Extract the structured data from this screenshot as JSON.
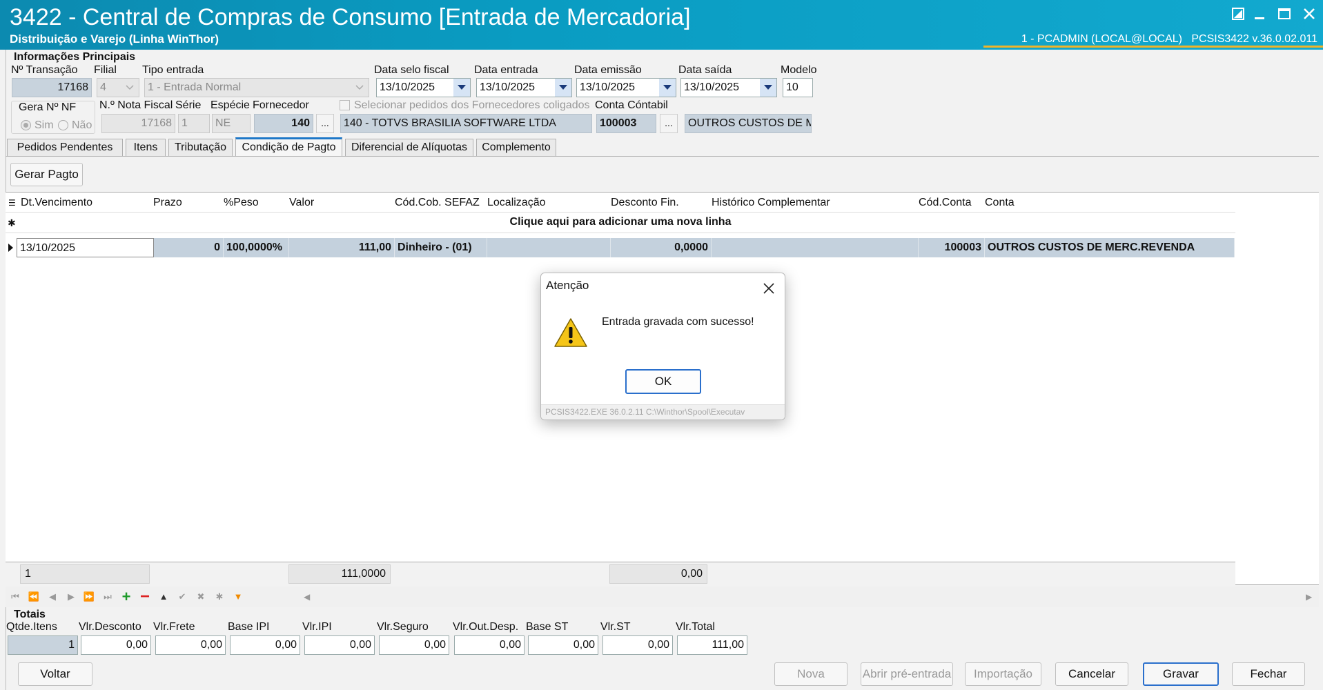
{
  "window": {
    "title": "3422 - Central de Compras de Consumo [Entrada de Mercadoria]",
    "subtitle": "Distribuição e Varejo (Linha WinThor)",
    "user_info": "1 - PCADMIN (LOCAL@LOCAL)",
    "version": "PCSIS3422  v.36.0.02.011"
  },
  "info": {
    "section_title": "Informações Principais",
    "transacao_label": "Nº Transação",
    "transacao_value": "17168",
    "filial_label": "Filial",
    "filial_value": "4",
    "tipo_entrada_label": "Tipo entrada",
    "tipo_entrada_value": "1 - Entrada Normal",
    "data_selo_label": "Data selo fiscal",
    "data_selo_value": "13/10/2025",
    "data_entrada_label": "Data entrada",
    "data_entrada_value": "13/10/2025",
    "data_emissao_label": "Data emissão",
    "data_emissao_value": "13/10/2025",
    "data_saida_label": "Data saída",
    "data_saida_value": "13/10/2025",
    "modelo_label": "Modelo",
    "modelo_value": "10",
    "gera_nf_label": "Gera Nº NF",
    "sim_label": "Sim",
    "nao_label": "Não",
    "nota_fiscal_label": "N.º Nota Fiscal",
    "nota_fiscal_value": "17168",
    "serie_label": "Série",
    "serie_value": "1",
    "especie_label": "Espécie",
    "especie_value": "NE",
    "fornecedor_label": "Fornecedor",
    "fornecedor_code": "140",
    "fornecedor_name": "140 - TOTVS BRASILIA SOFTWARE LTDA",
    "coligados_label": "Selecionar pedidos dos Fornecedores coligados",
    "conta_contabil_label": "Conta Cóntabil",
    "conta_contabil_code": "100003",
    "conta_contabil_name": "OUTROS CUSTOS DE MERC.REVENDA",
    "ellipsis": "..."
  },
  "tabs": [
    {
      "label": "Pedidos Pendentes"
    },
    {
      "label": "Itens"
    },
    {
      "label": "Tributação"
    },
    {
      "label": "Condição de Pagto"
    },
    {
      "label": "Diferencial de Alíquotas"
    },
    {
      "label": "Complemento"
    }
  ],
  "gerar_pagto_label": "Gerar Pagto",
  "grid": {
    "headers": [
      "Dt.Vencimento",
      "Prazo",
      "%Peso",
      "Valor",
      "Cód.Cob. SEFAZ",
      "Localização",
      "Desconto Fin.",
      "Histórico Complementar",
      "Cód.Conta",
      "Conta"
    ],
    "new_row_text": "Clique aqui para adicionar uma nova linha",
    "rows": [
      {
        "dt_vencimento": "13/10/2025",
        "prazo": "0",
        "peso": "100,0000%",
        "valor": "111,00",
        "cod_cob": "Dinheiro - (01)",
        "localizacao": "",
        "desconto_fin": "0,0000",
        "historico": "",
        "cod_conta": "100003",
        "conta": "OUTROS CUSTOS DE MERC.REVENDA"
      }
    ],
    "summary_count": "1",
    "summary_valor": "111,0000",
    "summary_desconto": "0,00"
  },
  "totals": {
    "section_title": "Totais",
    "qtde_itens_label": "Qtde.Itens",
    "qtde_itens": "1",
    "vlr_desconto_label": "Vlr.Desconto",
    "vlr_desconto": "0,00",
    "vlr_frete_label": "Vlr.Frete",
    "vlr_frete": "0,00",
    "base_ipi_label": "Base IPI",
    "base_ipi": "0,00",
    "vlr_ipi_label": "Vlr.IPI",
    "vlr_ipi": "0,00",
    "vlr_seguro_label": "Vlr.Seguro",
    "vlr_seguro": "0,00",
    "vlr_out_desp_label": "Vlr.Out.Desp.",
    "vlr_out_desp": "0,00",
    "base_st_label": "Base ST",
    "base_st": "0,00",
    "vlr_st_label": "Vlr.ST",
    "vlr_st": "0,00",
    "vlr_total_label": "Vlr.Total",
    "vlr_total": "111,00"
  },
  "footer_buttons": {
    "voltar": "Voltar",
    "nova": "Nova",
    "abrir_pre_entrada": "Abrir pré-entrada",
    "importacao": "Importação",
    "cancelar": "Cancelar",
    "gravar": "Gravar",
    "fechar": "Fechar"
  },
  "dialog": {
    "title": "Atenção",
    "message": "Entrada gravada com sucesso!",
    "ok_label": "OK",
    "footer": "PCSIS3422.EXE 36.0.2.11 C:\\Winthor\\Spool\\Executav"
  },
  "colors": {
    "titlebar": "#0c8ab0",
    "accent_tab": "#1e78c8",
    "selected_row": "#c4d1dd",
    "user_underline": "#f0b429"
  },
  "icons": [
    "restore-icon",
    "minimize-icon",
    "maximize-icon",
    "close-icon",
    "warning-icon",
    "dropdown-arrow-icon"
  ]
}
